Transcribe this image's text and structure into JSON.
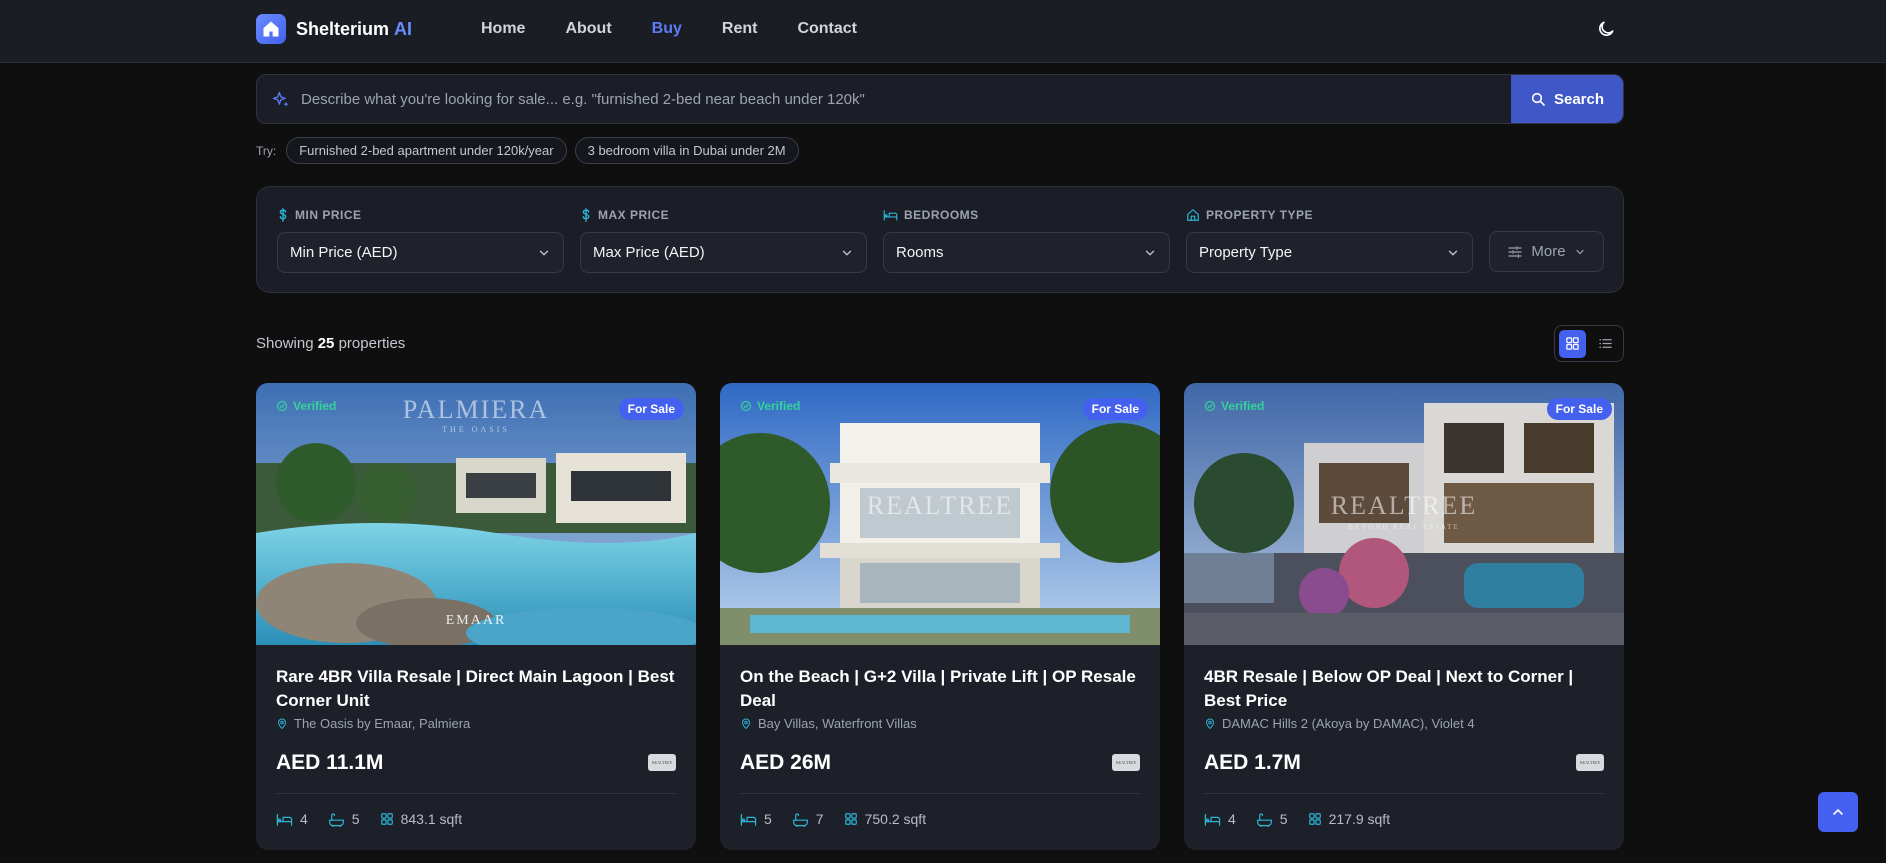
{
  "nav": {
    "brand_name": "Shelterium",
    "brand_ai": "AI",
    "links": [
      "Home",
      "About",
      "Buy",
      "Rent",
      "Contact"
    ],
    "active": "Buy"
  },
  "search": {
    "placeholder": "Describe what you're looking for sale... e.g. \"furnished 2-bed near beach under 120k\"",
    "button_label": "Search",
    "try_label": "Try:",
    "suggestions": [
      "Furnished 2-bed apartment under 120k/year",
      "3 bedroom villa in Dubai under 2M"
    ]
  },
  "filters": {
    "min_price": {
      "label": "MIN PRICE",
      "value": "Min Price (AED)"
    },
    "max_price": {
      "label": "MAX PRICE",
      "value": "Max Price (AED)"
    },
    "bedrooms": {
      "label": "BEDROOMS",
      "value": "Rooms"
    },
    "property_type": {
      "label": "PROPERTY TYPE",
      "value": "Property Type"
    },
    "more_label": "More"
  },
  "results": {
    "prefix": "Showing",
    "count": "25",
    "suffix": "properties"
  },
  "listings": [
    {
      "verified": "Verified",
      "status": "For Sale",
      "watermark_main": "PALMIERA",
      "watermark_sub": "THE OASIS",
      "watermark_bottom": "EMAAR",
      "title": "Rare 4BR Villa Resale | Direct Main Lagoon | Best Corner Unit",
      "location": "The Oasis by Emaar, Palmiera",
      "price": "AED 11.1M",
      "agency": "REALTREE",
      "beds": "4",
      "baths": "5",
      "area": "843.1 sqft"
    },
    {
      "verified": "Verified",
      "status": "For Sale",
      "watermark_main": "REALTREE",
      "watermark_sub": "",
      "watermark_bottom": "",
      "title": "On the Beach | G+2 Villa | Private Lift | OP Resale Deal",
      "location": "Bay Villas, Waterfront Villas",
      "price": "AED 26M",
      "agency": "REALTREE",
      "beds": "5",
      "baths": "7",
      "area": "750.2 sqft"
    },
    {
      "verified": "Verified",
      "status": "For Sale",
      "watermark_main": "REALTREE",
      "watermark_sub": "BEYOND REAL ESTATE",
      "watermark_bottom": "",
      "title": "4BR Resale | Below OP Deal | Next to Corner | Best Price",
      "location": "DAMAC Hills 2 (Akoya by DAMAC), Violet 4",
      "price": "AED 1.7M",
      "agency": "REALTREE",
      "beds": "4",
      "baths": "5",
      "area": "217.9 sqft"
    }
  ],
  "colors": {
    "accent": "#4361ee",
    "verified": "#34d399",
    "background": "#0f0f10"
  }
}
